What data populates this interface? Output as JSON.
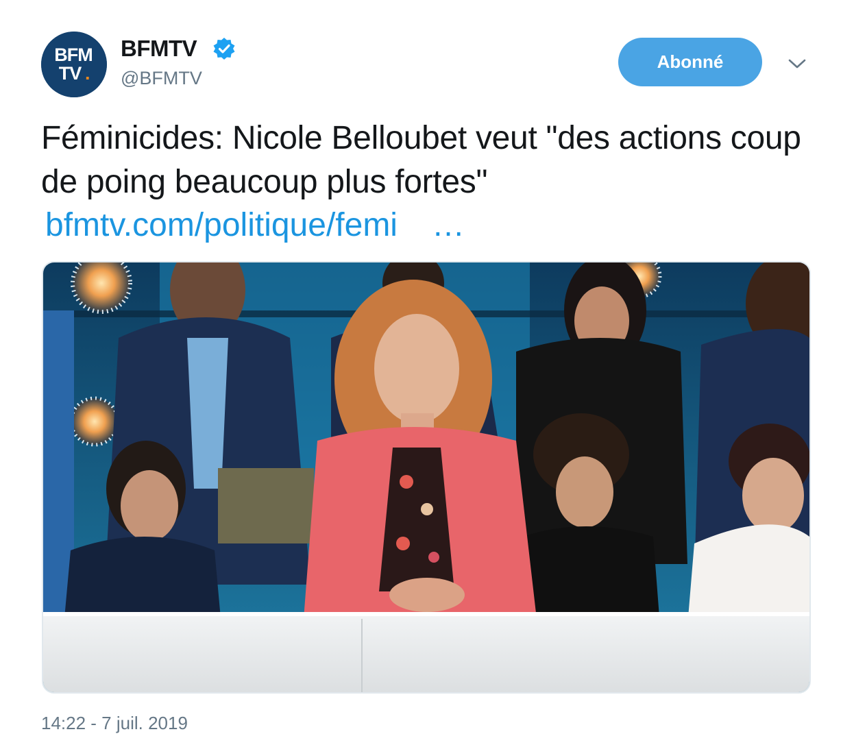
{
  "account": {
    "display_name": "BFMTV",
    "handle": "@BFMTV",
    "verified": true,
    "avatar_logo_line1": "BFM",
    "avatar_logo_line2": "TV",
    "avatar_logo_dot": ".",
    "brand_color": "#14416e",
    "accent_dot_color": "#e8871e"
  },
  "actions": {
    "follow_label": "Abonné",
    "follow_color": "#4aa4e4",
    "menu_icon": "chevron-down-icon"
  },
  "tweet": {
    "text": "Féminicides: Nicole Belloubet veut \"des actions coup de poing beaucoup plus fortes\"",
    "link_text": "bfmtv.com/politique/femi",
    "link_ellipsis": "…",
    "link_color": "#1b95e0",
    "timestamp": "14:22 - 7 juil. 2019"
  },
  "media": {
    "icon": "tv-studio-photo"
  }
}
